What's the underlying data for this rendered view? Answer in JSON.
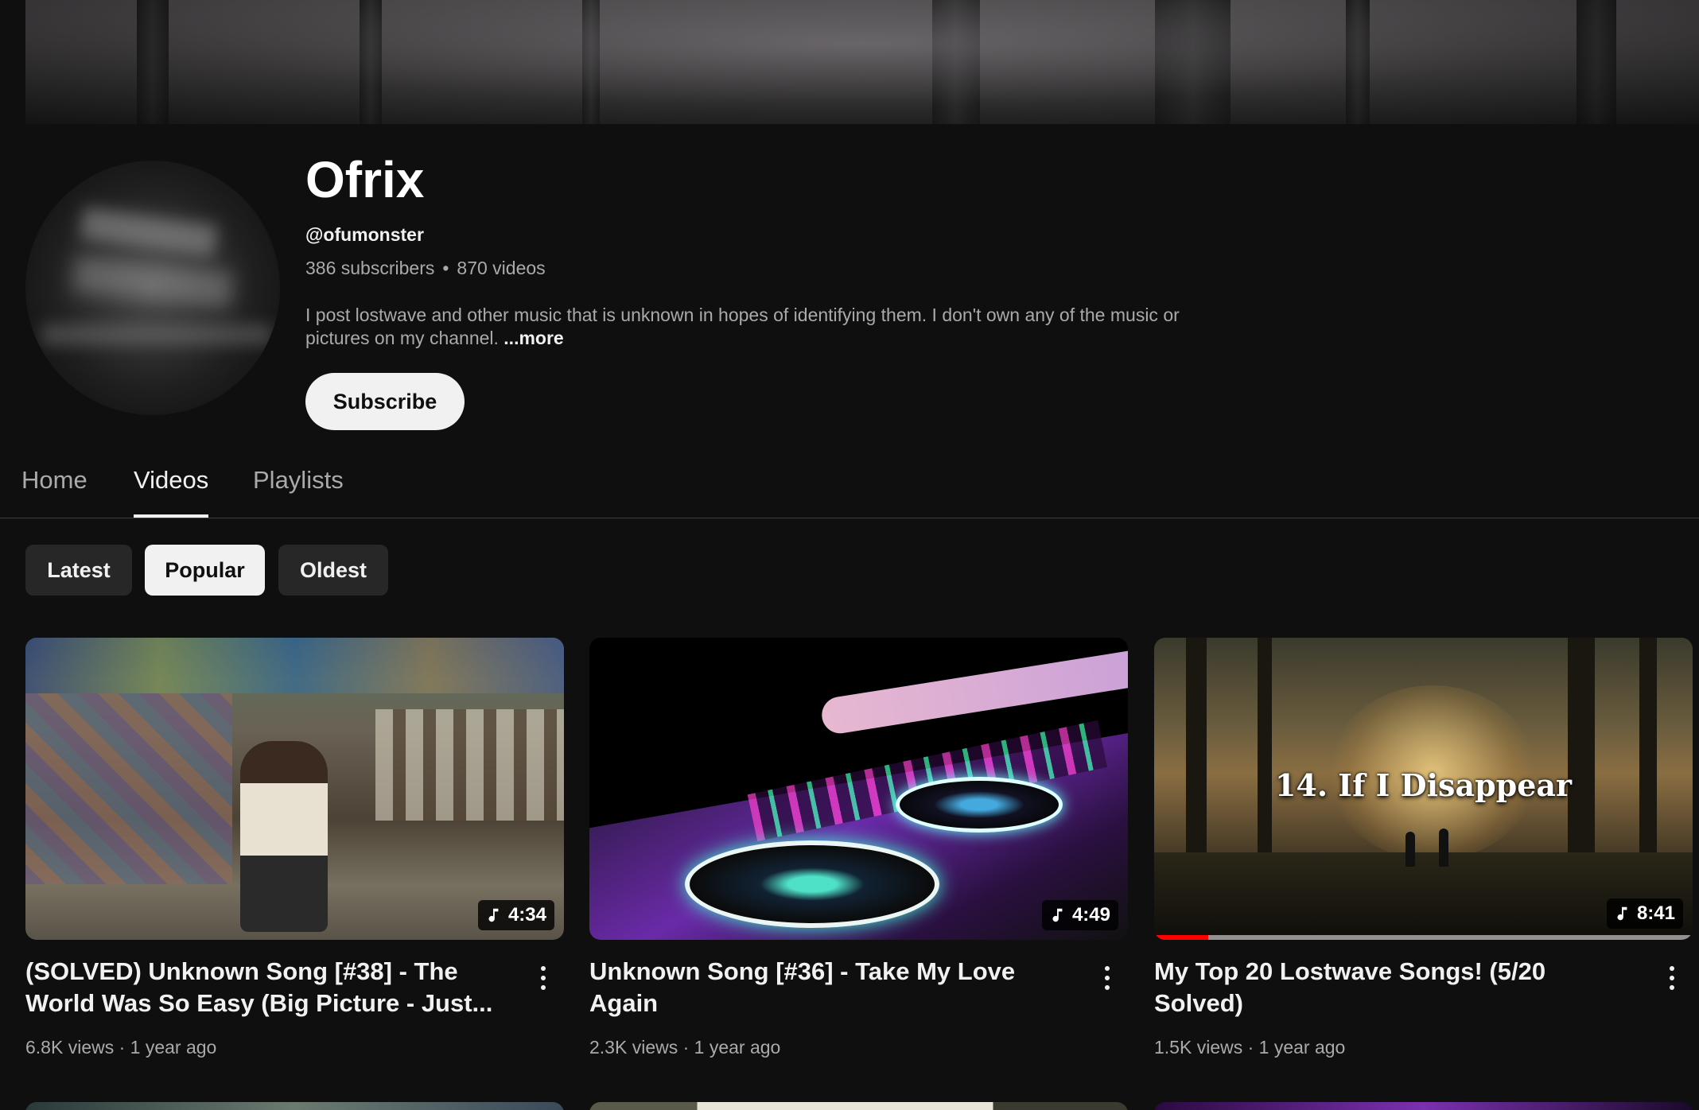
{
  "channel": {
    "name": "Ofrix",
    "handle": "@ofumonster",
    "subscribers": "386 subscribers",
    "video_count": "870 videos",
    "description": "I post lostwave and other music that is unknown in hopes of identifying them.  I don't own any of the music or pictures on my channel.",
    "more_label": "...more",
    "subscribe_label": "Subscribe"
  },
  "tabs": [
    {
      "label": "Home",
      "active": false
    },
    {
      "label": "Videos",
      "active": true
    },
    {
      "label": "Playlists",
      "active": false
    }
  ],
  "filters": [
    {
      "label": "Latest",
      "selected": false
    },
    {
      "label": "Popular",
      "selected": true
    },
    {
      "label": "Oldest",
      "selected": false
    }
  ],
  "videos": [
    {
      "title": "(SOLVED) Unknown Song [#38] - The World Was So Easy (Big Picture - Just...",
      "duration": "4:34",
      "meta": "6.8K views · 1 year ago",
      "thumb_icon": "music-note-icon"
    },
    {
      "title": "Unknown Song [#36] - Take My Love Again",
      "duration": "4:49",
      "meta": "2.3K views · 1 year ago",
      "thumb_icon": "music-note-icon"
    },
    {
      "title": "My Top 20 Lostwave Songs! (5/20 Solved)",
      "duration": "8:41",
      "meta": "1.5K views · 1 year ago",
      "thumb_caption": "14. If I Disappear",
      "watch_progress": 0.1,
      "thumb_icon": "music-note-icon"
    }
  ],
  "colors": {
    "background": "#0f0f0f",
    "text_primary": "#f1f1f1",
    "text_secondary": "#aaaaaa",
    "progress": "#ff0000"
  }
}
